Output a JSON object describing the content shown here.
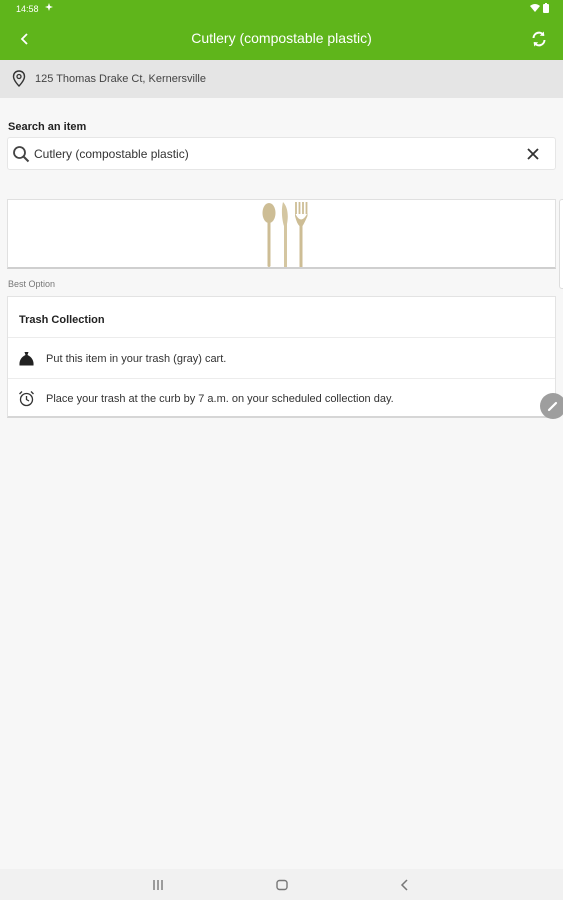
{
  "status_bar": {
    "time": "14:58",
    "extra_icon": "sync-status-icon"
  },
  "app_bar": {
    "title": "Cutlery (compostable plastic)",
    "back_icon": "chevron-left-icon",
    "refresh_icon": "refresh-icon"
  },
  "address": {
    "text": "125 Thomas Drake Ct, Kernersville",
    "icon": "location-pin-icon"
  },
  "search": {
    "label": "Search an item",
    "value": "Cutlery (compostable plastic)",
    "search_icon": "search-icon",
    "clear_icon": "close-icon"
  },
  "item_image": {
    "icon": "cutlery-image"
  },
  "best_option_label": "Best Option",
  "result": {
    "title": "Trash Collection",
    "rows": [
      {
        "icon": "trash-bag-icon",
        "text": "Put this item in your trash (gray) cart."
      },
      {
        "icon": "alarm-clock-icon",
        "text": "Place your trash at the curb by 7 a.m. on your scheduled collection day."
      }
    ]
  },
  "colors": {
    "primary": "#5fb51b",
    "address_bg": "#e5e5e5",
    "page_bg": "#f7f7f7"
  },
  "nav_bar": {
    "icons": [
      "recent-apps-icon",
      "home-icon",
      "back-icon"
    ]
  }
}
